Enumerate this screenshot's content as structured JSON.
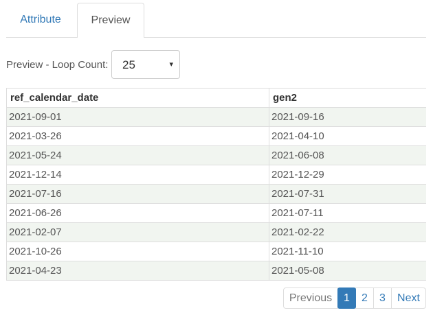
{
  "tabs": [
    {
      "label": "Attribute",
      "active": false
    },
    {
      "label": "Preview",
      "active": true
    }
  ],
  "loop_count": {
    "label": "Preview - Loop Count:",
    "value": "25",
    "arrow": "▾"
  },
  "table": {
    "headers": [
      "ref_calendar_date",
      "gen2"
    ],
    "rows": [
      [
        "2021-09-01",
        "2021-09-16"
      ],
      [
        "2021-03-26",
        "2021-04-10"
      ],
      [
        "2021-05-24",
        "2021-06-08"
      ],
      [
        "2021-12-14",
        "2021-12-29"
      ],
      [
        "2021-07-16",
        "2021-07-31"
      ],
      [
        "2021-06-26",
        "2021-07-11"
      ],
      [
        "2021-02-07",
        "2021-02-22"
      ],
      [
        "2021-10-26",
        "2021-11-10"
      ],
      [
        "2021-04-23",
        "2021-05-08"
      ]
    ]
  },
  "pagination": {
    "previous": "Previous",
    "pages": [
      "1",
      "2",
      "3"
    ],
    "current": "1",
    "next": "Next"
  },
  "colors": {
    "link": "#337ab7",
    "active_page_bg": "#337ab7",
    "striped_row_bg": "#f1f5f0",
    "border": "#dddddd"
  }
}
